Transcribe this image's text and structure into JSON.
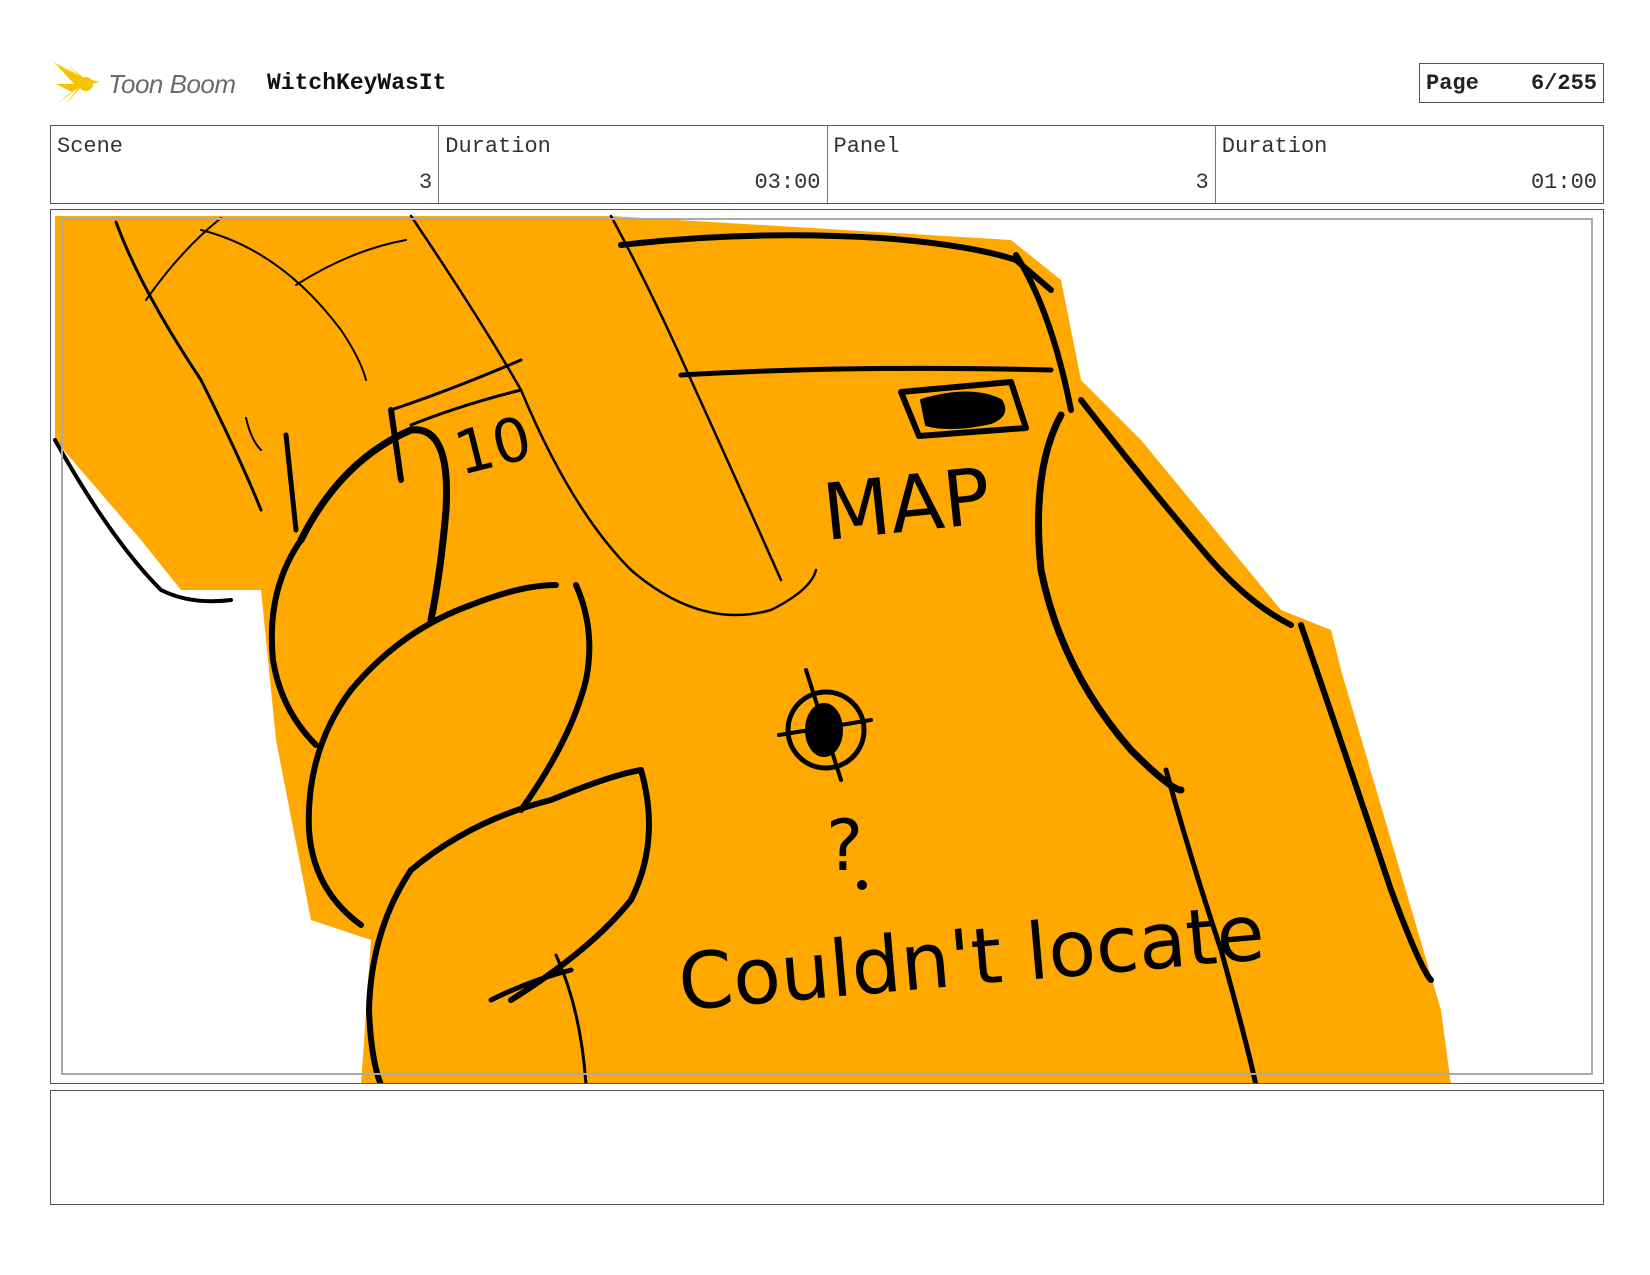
{
  "header": {
    "logo_text": "Toon Boom",
    "project_title": "WitchKeyWasIt",
    "page_label": "Page",
    "page_value": "6/255"
  },
  "info": {
    "scene_label": "Scene",
    "scene_value": "3",
    "scene_duration_label": "Duration",
    "scene_duration_value": "03:00",
    "panel_label": "Panel",
    "panel_value": "3",
    "panel_duration_label": "Duration",
    "panel_duration_value": "01:00"
  },
  "drawing": {
    "text_10": "10",
    "text_map": "MAP",
    "text_question": "?",
    "text_caption": "Couldn't locate",
    "fill_color": "#FFA800",
    "ink_color": "#000000"
  },
  "notes": {
    "text": ""
  },
  "colors": {
    "logo_yellow": "#F5C400",
    "border": "#555555",
    "safe_frame": "#AAAAAA"
  }
}
